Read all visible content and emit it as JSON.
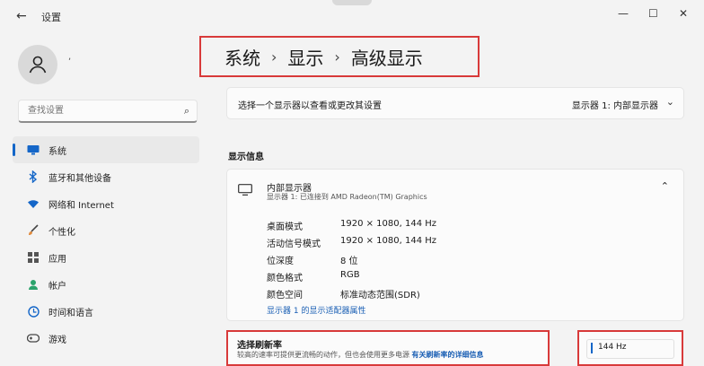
{
  "window": {
    "title": "设置",
    "back_icon": "arrow-left-icon",
    "controls": [
      "—",
      "☐",
      "✕"
    ]
  },
  "user": {
    "name": ","
  },
  "search": {
    "placeholder": "查找设置"
  },
  "sidebar": {
    "items": [
      {
        "label": "系统",
        "icon": "monitor-icon",
        "active": true
      },
      {
        "label": "蓝牙和其他设备",
        "icon": "bluetooth-icon"
      },
      {
        "label": "网络和 Internet",
        "icon": "wifi-icon"
      },
      {
        "label": "个性化",
        "icon": "brush-icon"
      },
      {
        "label": "应用",
        "icon": "apps-icon"
      },
      {
        "label": "帐户",
        "icon": "person-icon"
      },
      {
        "label": "时间和语言",
        "icon": "globe-icon"
      },
      {
        "label": "游戏",
        "icon": "gamepad-icon"
      }
    ]
  },
  "breadcrumb": {
    "items": [
      "系统",
      "显示",
      "高级显示"
    ],
    "separator": "›"
  },
  "display_select": {
    "label": "选择一个显示器以查看或更改其设置",
    "value": "显示器 1: 内部显示器"
  },
  "display_info": {
    "section_title": "显示信息",
    "name": "内部显示器",
    "subtitle": "显示器 1: 已连接到 AMD Radeon(TM) Graphics",
    "rows": [
      {
        "key": "桌面模式",
        "value": "1920 × 1080, 144 Hz"
      },
      {
        "key": "活动信号模式",
        "value": "1920 × 1080, 144 Hz"
      },
      {
        "key": "位深度",
        "value": "8 位"
      },
      {
        "key": "颜色格式",
        "value": "RGB"
      },
      {
        "key": "颜色空间",
        "value": "标准动态范围(SDR)"
      }
    ],
    "adapter_link": "显示器 1 的显示适配器属性"
  },
  "refresh_rate": {
    "title": "选择刷新率",
    "description": "较高的速率可提供更流畅的动作，但也会使用更多电源",
    "link": "有关刷新率的详细信息",
    "value": "144 Hz"
  },
  "colors": {
    "accent": "#1466c8",
    "highlight_border": "#d83a3a"
  }
}
